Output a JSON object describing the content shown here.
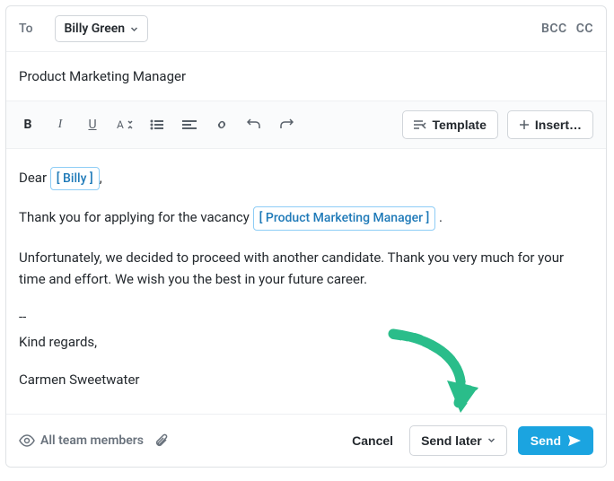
{
  "header": {
    "to_label": "To",
    "bcc_label": "BCC",
    "cc_label": "CC"
  },
  "recipient": {
    "name": "Billy Green"
  },
  "subject": "Product Marketing Manager",
  "toolbar": {
    "template_label": "Template",
    "insert_label": "Insert…"
  },
  "body": {
    "greeting_prefix": "Dear ",
    "greeting_token": "[ Billy ]",
    "greeting_suffix": ",",
    "line1_prefix": "Thank you for applying for the vacancy ",
    "line1_token": "[ Product Marketing Manager ]",
    "line1_suffix": " .",
    "line2": "Unfortunately, we decided to proceed with another candidate. Thank you very much for your time and effort. We wish you the best in your future career.",
    "sep": "--",
    "signoff1": "Kind regards,",
    "signoff2": "Carmen Sweetwater"
  },
  "footer": {
    "visibility_label": "All team members",
    "cancel_label": "Cancel",
    "send_later_label": "Send later",
    "send_label": "Send"
  }
}
